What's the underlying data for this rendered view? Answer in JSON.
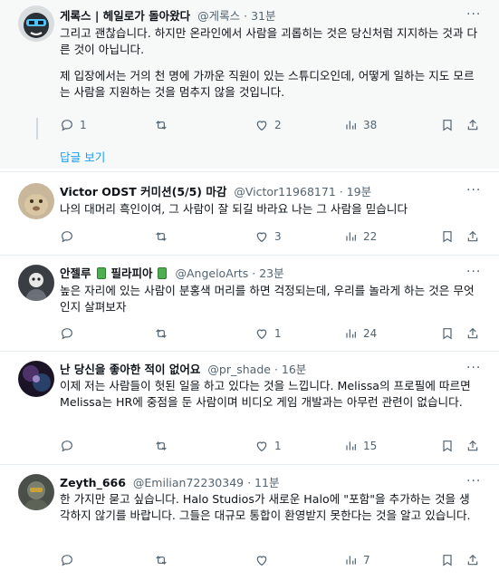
{
  "tweets": [
    {
      "name": "게록스 | 헤일로가 돌아왔다",
      "handle": "@게록스",
      "time": "31분",
      "paragraphs": [
        "그리고 괜찮습니다. 하지만 온라인에서 사람을 괴롭히는 것은 당신처럼 지지하는 것과 다른 것이 아닙니다.",
        "제 입장에서는 거의 천 명에 가까운 직원이 있는 스튜디오인데, 어떻게 일하는 지도 모르는 사람을 지원하는 것을 멈추지 않을 것입니다."
      ],
      "replies": "1",
      "retweets": "",
      "likes": "2",
      "views": "38",
      "show_replies": "답글 보기"
    },
    {
      "name": "Victor ODST 커미션(5/5) 마감",
      "handle": "@Victor11968171",
      "time": "19분",
      "paragraphs": [
        "나의 대머리 흑인이여, 그 사람이 잘 되길 바라요 나는 그 사람을 믿습니다"
      ],
      "replies": "",
      "retweets": "",
      "likes": "3",
      "views": "22"
    },
    {
      "name_parts": [
        "안젤루",
        "필라피아"
      ],
      "handle": "@AngeloArts",
      "time": "23분",
      "paragraphs": [
        "높은 자리에 있는 사람이 분홍색 머리를 하면 걱정되는데, 우리를 놀라게 하는 것은 무엇인지 살펴보자"
      ],
      "replies": "",
      "retweets": "",
      "likes": "1",
      "views": "24"
    },
    {
      "name": "난 당신을 좋아한 적이 없어요",
      "handle": "@pr_shade",
      "time": "16분",
      "paragraphs": [
        "이제 저는 사람들이 헛된 일을 하고 있다는 것을 느낍니다. Melissa의 프로필에 따르면 Melissa는 HR에 중점을 둔 사람이며 비디오 게임 개발과는 아무런 관련이 없습니다."
      ],
      "replies": "",
      "retweets": "",
      "likes": "1",
      "views": "15"
    },
    {
      "name": "Zeyth_666",
      "handle": "@Emilian72230349",
      "time": "11분",
      "paragraphs": [
        "한 가지만 묻고 싶습니다. Halo Studios가 새로운 Halo에 \"포함\"을 추가하는 것을 생각하지 않기를 바랍니다. 그들은 대규모 통합이 환영받지 못한다는 것을 알고 있습니다."
      ],
      "replies": "",
      "retweets": "",
      "likes": "",
      "views": "7"
    }
  ],
  "colors": {
    "accent": "#1d9bf0",
    "secondary": "#536471",
    "divider": "#e6ecf0",
    "highlight_bg": "#f7f9f9"
  },
  "icons": [
    "reply-icon",
    "retweet-icon",
    "like-icon",
    "views-icon",
    "bookmark-icon",
    "share-icon",
    "more-icon"
  ]
}
